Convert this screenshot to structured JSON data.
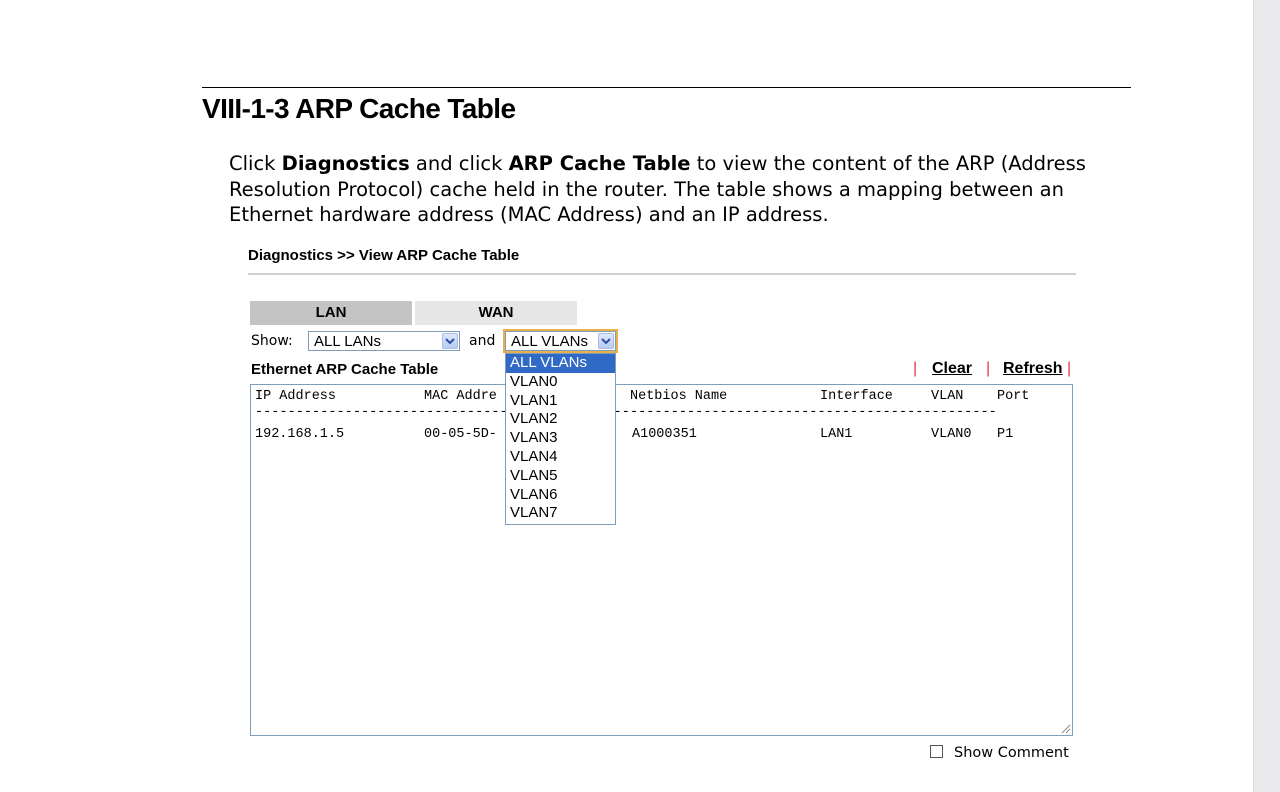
{
  "document": {
    "section_title": "VIII-1-3 ARP Cache Table",
    "intro": {
      "p1": "Click ",
      "b1": "Diagnostics",
      "p2": " and click ",
      "b2": "ARP Cache Table",
      "p3": " to view the content of the ARP (Address Resolution Protocol) cache held in the router. The table shows a mapping between an Ethernet hardware address (MAC Address) and an IP address."
    }
  },
  "router_ui": {
    "breadcrumb": "Diagnostics >> View ARP Cache Table",
    "tabs": [
      {
        "label": "LAN",
        "active": true
      },
      {
        "label": "WAN",
        "active": false
      }
    ],
    "filters": {
      "show_label": "Show:",
      "lan_select_value": "ALL LANs",
      "and_label": "and",
      "vlan_select_value": "ALL VLANs",
      "vlan_options": [
        "ALL VLANs",
        "VLAN0",
        "VLAN1",
        "VLAN2",
        "VLAN3",
        "VLAN4",
        "VLAN5",
        "VLAN6",
        "VLAN7"
      ],
      "vlan_selected_index": 0
    },
    "table_title": "Ethernet ARP Cache Table",
    "actions": {
      "clear": "Clear",
      "refresh": "Refresh"
    },
    "columns": [
      "IP Address",
      "MAC Addre",
      "Netbios Name",
      "Interface",
      "VLAN",
      "Port"
    ],
    "rows": [
      {
        "ip": "192.168.1.5",
        "mac": "00-05-5D-",
        "netbios": "A1000351",
        "interface": "LAN1",
        "vlan": "VLAN0",
        "port": "P1"
      }
    ],
    "show_comment": {
      "label": "Show Comment",
      "checked": false
    }
  },
  "colors": {
    "tab_active": "#c4c4c4",
    "tab_inactive": "#e6e6e6",
    "selection_blue": "#3169c6",
    "border_blue": "#7f9db9",
    "pipe_red": "#e23a3a",
    "focus_orange": "#e8b04c"
  }
}
